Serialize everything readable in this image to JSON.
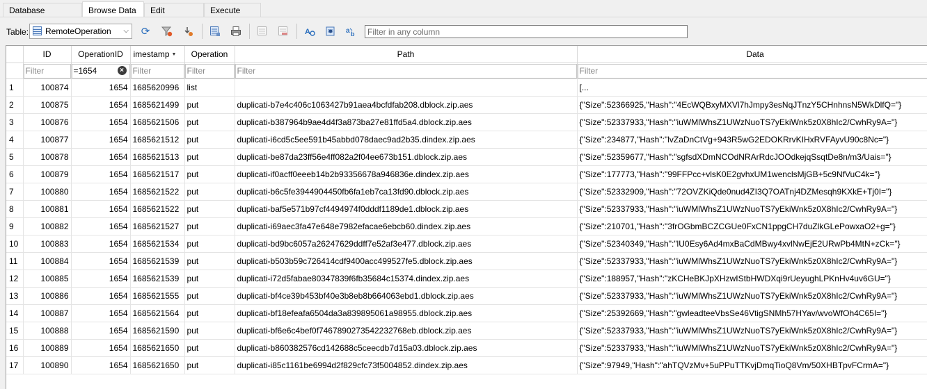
{
  "tabs": [
    {
      "label": "Database Structure",
      "active": false
    },
    {
      "label": "Browse Data",
      "active": true
    },
    {
      "label": "Edit Pragmas",
      "active": false
    },
    {
      "label": "Execute SQL",
      "active": false
    }
  ],
  "toolbar": {
    "table_label": "Table:",
    "table_value": "RemoteOperation",
    "filter_placeholder": "Filter in any column",
    "icons": [
      "refresh-icon",
      "clear-filters-icon",
      "clear-sorting-icon",
      "save-table-icon",
      "print-icon",
      "new-record-icon",
      "delete-record-icon",
      "find-icon",
      "find-replace-icon",
      "set-encoding-icon"
    ]
  },
  "columns": [
    "ID",
    "OperationID",
    "imestamp",
    "Operation",
    "Path",
    "Data"
  ],
  "filter_placeholder": "Filter",
  "column_filters": [
    "",
    "=1654",
    "",
    "",
    "",
    ""
  ],
  "rows": [
    {
      "n": "1",
      "id": "100874",
      "op": "1654",
      "ts": "1685620996",
      "type": "list",
      "path": "",
      "data": "[..."
    },
    {
      "n": "2",
      "id": "100875",
      "op": "1654",
      "ts": "1685621499",
      "type": "put",
      "path": "duplicati-b7e4c406c1063427b91aea4bcfdfab208.dblock.zip.aes",
      "data": "{\"Size\":52366925,\"Hash\":\"4EcWQBxyMXVl7hJmpy3esNqJTnzY5CHnhnsN5WkDlfQ=\"}"
    },
    {
      "n": "3",
      "id": "100876",
      "op": "1654",
      "ts": "1685621506",
      "type": "put",
      "path": "duplicati-b387964b9ae4d4f3a873ba27e81ffd5a4.dblock.zip.aes",
      "data": "{\"Size\":52337933,\"Hash\":\"iuWMlWhsZ1UWzNuoTS7yEkiWnk5z0X8hIc2/CwhRy9A=\"}"
    },
    {
      "n": "4",
      "id": "100877",
      "op": "1654",
      "ts": "1685621512",
      "type": "put",
      "path": "duplicati-i6cd5c5ee591b45abbd078daec9ad2b35.dindex.zip.aes",
      "data": "{\"Size\":234877,\"Hash\":\"lvZaDnCtVg+943R5wG2EDOKRrvKIHxRVFAyvU90c8Nc=\"}"
    },
    {
      "n": "5",
      "id": "100878",
      "op": "1654",
      "ts": "1685621513",
      "type": "put",
      "path": "duplicati-be87da23ff56e4ff082a2f04ee673b151.dblock.zip.aes",
      "data": "{\"Size\":52359677,\"Hash\":\"sgfsdXDmNCOdNRArRdcJOOdkejqSsqtDe8n/m3/Uais=\"}"
    },
    {
      "n": "6",
      "id": "100879",
      "op": "1654",
      "ts": "1685621517",
      "type": "put",
      "path": "duplicati-if0acff0eeeb14b2b93356678a946836e.dindex.zip.aes",
      "data": "{\"Size\":177773,\"Hash\":\"99FFPcc+vlsK0E2gvhxUM1wenclsMjGB+5c9NfVuC4k=\"}"
    },
    {
      "n": "7",
      "id": "100880",
      "op": "1654",
      "ts": "1685621522",
      "type": "put",
      "path": "duplicati-b6c5fe3944904450fb6fa1eb7ca13fd90.dblock.zip.aes",
      "data": "{\"Size\":52332909,\"Hash\":\"72OVZKiQde0nud4ZI3Q7OATnj4DZMesqh9KXkE+Tj0I=\"}"
    },
    {
      "n": "8",
      "id": "100881",
      "op": "1654",
      "ts": "1685621522",
      "type": "put",
      "path": "duplicati-baf5e571b97cf4494974f0dddf1189de1.dblock.zip.aes",
      "data": "{\"Size\":52337933,\"Hash\":\"iuWMlWhsZ1UWzNuoTS7yEkiWnk5z0X8hIc2/CwhRy9A=\"}"
    },
    {
      "n": "9",
      "id": "100882",
      "op": "1654",
      "ts": "1685621527",
      "type": "put",
      "path": "duplicati-i69aec3fa47e648e7982efacae6ebcb60.dindex.zip.aes",
      "data": "{\"Size\":210701,\"Hash\":\"3frOGbmBCZCGUe0FxCN1ppgCH7duZlkGLePowxaO2+g=\"}"
    },
    {
      "n": "10",
      "id": "100883",
      "op": "1654",
      "ts": "1685621534",
      "type": "put",
      "path": "duplicati-bd9bc6057a26247629ddff7e52af3e477.dblock.zip.aes",
      "data": "{\"Size\":52340349,\"Hash\":\"lU0Esy6Ad4mxBaCdMBwy4xvlNwEjE2URwPb4MtN+zCk=\"}"
    },
    {
      "n": "11",
      "id": "100884",
      "op": "1654",
      "ts": "1685621539",
      "type": "put",
      "path": "duplicati-b503b59c726414cdf9400acc499527fe5.dblock.zip.aes",
      "data": "{\"Size\":52337933,\"Hash\":\"iuWMlWhsZ1UWzNuoTS7yEkiWnk5z0X8hIc2/CwhRy9A=\"}"
    },
    {
      "n": "12",
      "id": "100885",
      "op": "1654",
      "ts": "1685621539",
      "type": "put",
      "path": "duplicati-i72d5fabae80347839f6fb35684c15374.dindex.zip.aes",
      "data": "{\"Size\":188957,\"Hash\":\"zKCHeBKJpXHzwIStbHWDXqi9rUeyughLPKnHv4uv6GU=\"}"
    },
    {
      "n": "13",
      "id": "100886",
      "op": "1654",
      "ts": "1685621555",
      "type": "put",
      "path": "duplicati-bf4ce39b453bf40e3b8eb8b664063ebd1.dblock.zip.aes",
      "data": "{\"Size\":52337933,\"Hash\":\"iuWMlWhsZ1UWzNuoTS7yEkiWnk5z0X8hIc2/CwhRy9A=\"}"
    },
    {
      "n": "14",
      "id": "100887",
      "op": "1654",
      "ts": "1685621564",
      "type": "put",
      "path": "duplicati-bf18efeafa6504da3a839895061a98955.dblock.zip.aes",
      "data": "{\"Size\":25392669,\"Hash\":\"gwleadteeVbsSe46VtigSNMh57HYav/wvoWfOh4C65I=\"}"
    },
    {
      "n": "15",
      "id": "100888",
      "op": "1654",
      "ts": "1685621590",
      "type": "put",
      "path": "duplicati-bf6e6c4bef0f7467890273542232768eb.dblock.zip.aes",
      "data": "{\"Size\":52337933,\"Hash\":\"iuWMlWhsZ1UWzNuoTS7yEkiWnk5z0X8hIc2/CwhRy9A=\"}"
    },
    {
      "n": "16",
      "id": "100889",
      "op": "1654",
      "ts": "1685621650",
      "type": "put",
      "path": "duplicati-b860382576cd142688c5ceecdb7d15a03.dblock.zip.aes",
      "data": "{\"Size\":52337933,\"Hash\":\"iuWMlWhsZ1UWzNuoTS7yEkiWnk5z0X8hIc2/CwhRy9A=\"}"
    },
    {
      "n": "17",
      "id": "100890",
      "op": "1654",
      "ts": "1685621650",
      "type": "put",
      "path": "duplicati-i85c1161be6994d2f829cfc73f5004852.dindex.zip.aes",
      "data": "{\"Size\":97949,\"Hash\":\"ahTQVzMv+5uPPuTTKvjDmqTioQ8Vm/50XHBTpvFCrmA=\"}"
    }
  ]
}
